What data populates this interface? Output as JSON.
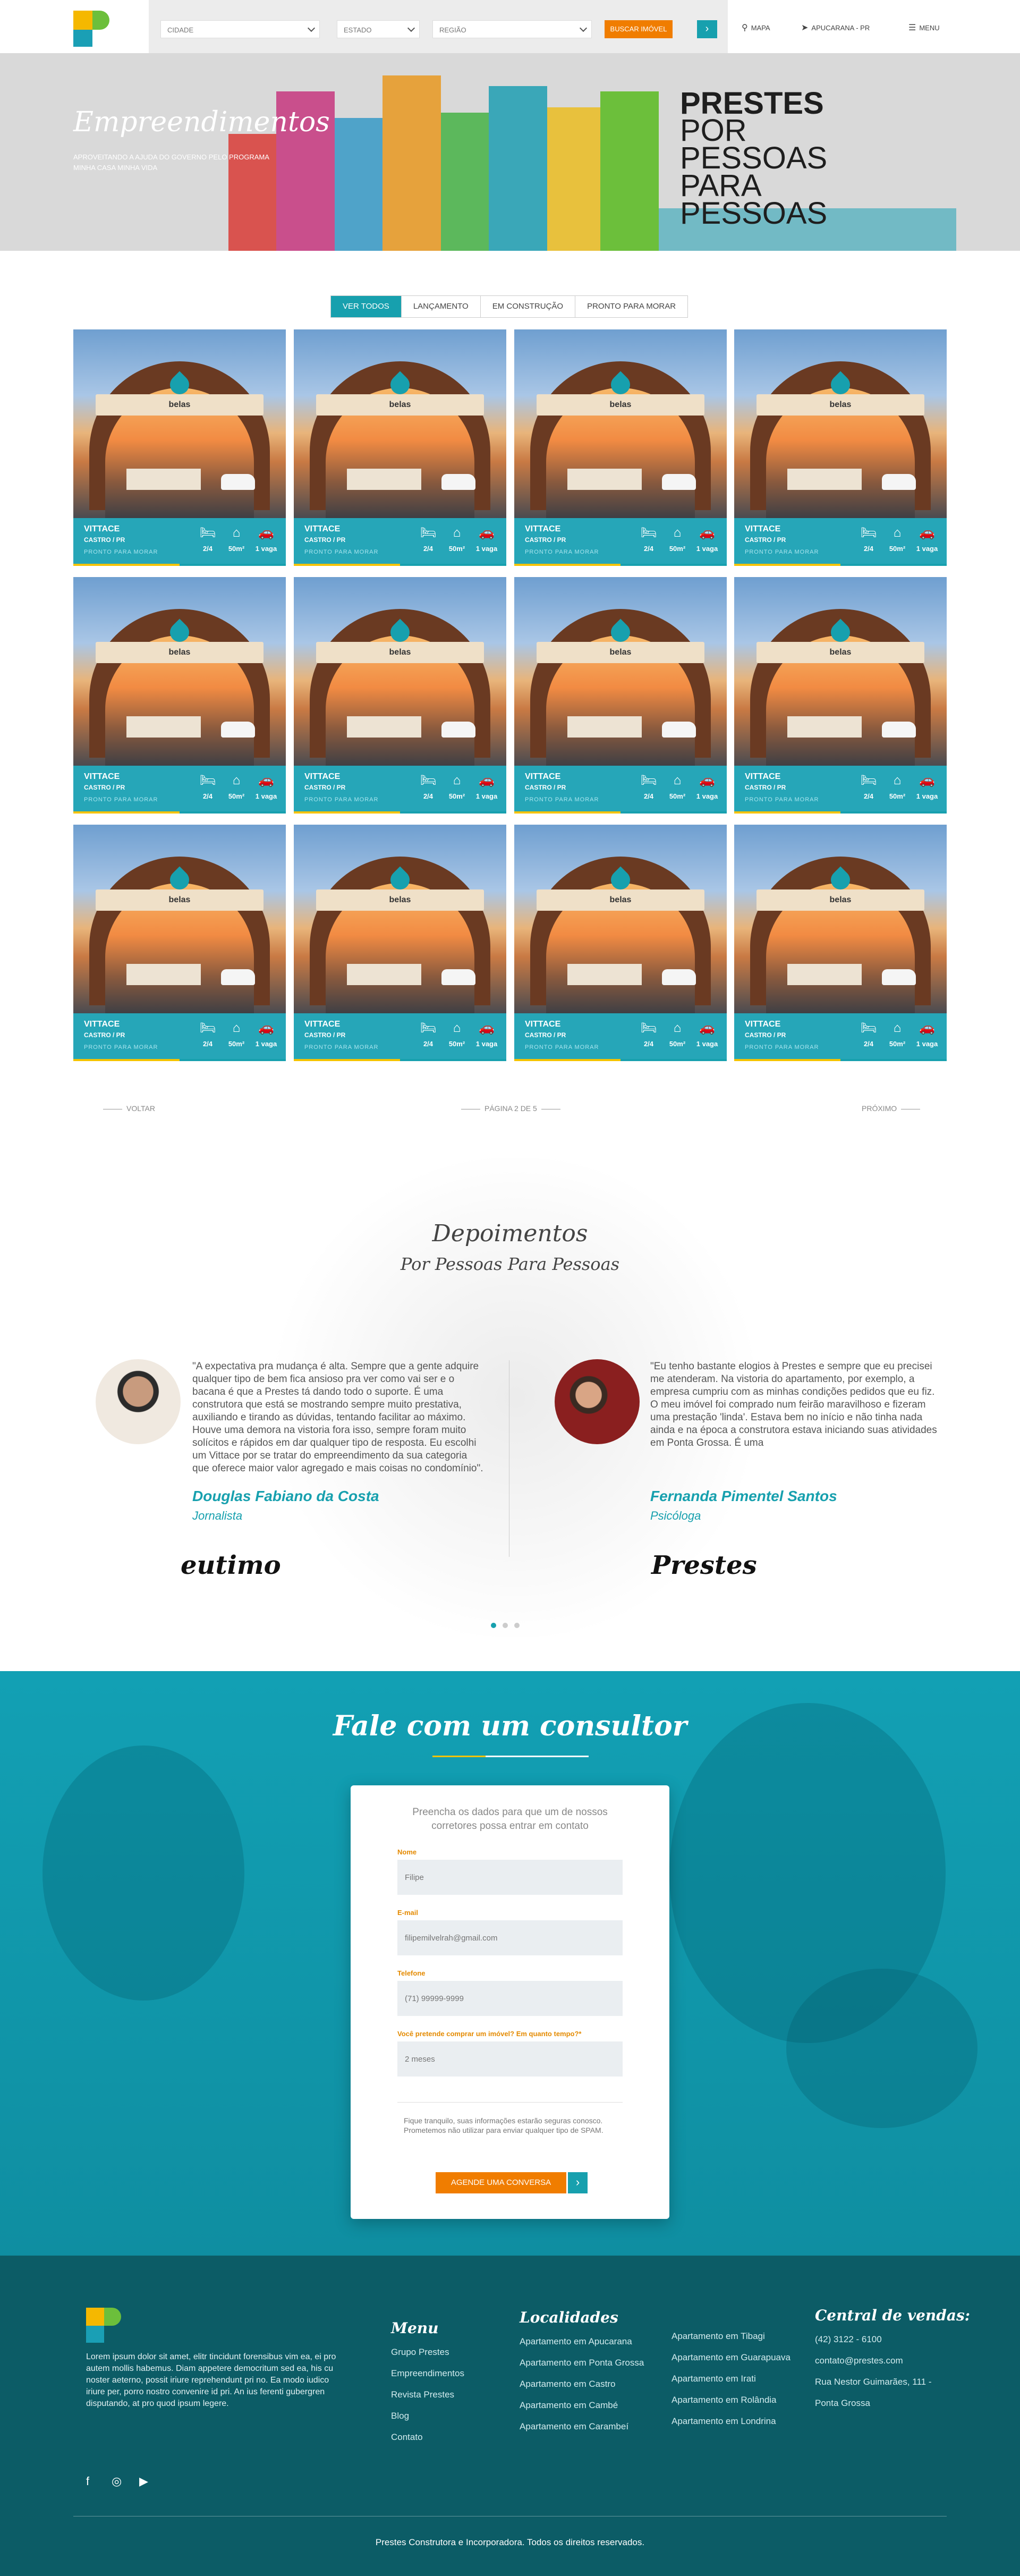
{
  "header": {
    "city_placeholder": "CIDADE",
    "state_placeholder": "ESTADO",
    "region_placeholder": "REGIÃO",
    "search_label": "BUSCAR IMÓVEL",
    "map_label": "MAPA",
    "location_label": "APUCARANA - PR",
    "menu_label": "MENU"
  },
  "hero": {
    "title": "Empreendimentos",
    "subtitle": "APROVEITANDO A AJUDA DO GOVERNO PELO PROGRAMA MINHA CASA MINHA VIDA",
    "brand": "PRESTES",
    "slogan": [
      "POR",
      "PESSOAS",
      "PARA",
      "PESSOAS"
    ]
  },
  "filters": {
    "tabs": [
      "VER TODOS",
      "LANÇAMENTO",
      "EM CONSTRUÇÃO",
      "PRONTO PARA MORAR"
    ],
    "active": "VER TODOS"
  },
  "cards": {
    "name": "VITTACE",
    "city": "CASTRO / PR",
    "status": "PRONTO PARA MORAR",
    "sign": "belas",
    "bedrooms": "2/4",
    "area": "50m²",
    "parking": "1 vaga"
  },
  "pagination": {
    "prev": "VOLTAR",
    "page_info": "PÁGINA 2 DE 5",
    "next": "PRÓXIMO"
  },
  "testimonials": {
    "title": "Depoimentos",
    "subtitle": "Por Pessoas Para Pessoas",
    "items": [
      {
        "quote": "\"A expectativa pra mudança é alta. Sempre que a gente adquire qualquer tipo de bem fica ansioso pra ver como vai ser e o bacana é que a Prestes tá dando todo o suporte. É uma construtora que está se mostrando sempre muito prestativa, auxiliando e tirando as dúvidas, tentando facilitar ao máximo. Houve uma demora na vistoria fora isso, sempre foram muito solícitos e rápidos em dar qualquer tipo de resposta. Eu escolhi um Vittace por se tratar do empreendimento da sua categoria que oferece maior valor agregado e mais coisas no condomínio\".",
        "name": "Douglas Fabiano da Costa",
        "role": "Jornalista",
        "signature": "eutimo"
      },
      {
        "quote": "\"Eu tenho bastante elogios à Prestes e sempre que eu precisei me atenderam. Na vistoria do apartamento, por exemplo, a empresa cumpriu com as minhas condições pedidos que eu fiz. O meu imóvel foi comprado num feirão maravilhoso e fizeram uma prestação 'linda'. Estava bem no início e não tinha nada ainda e na época a construtora estava iniciando suas atividades em Ponta Grossa. É uma",
        "name": "Fernanda Pimentel Santos",
        "role": "Psicóloga",
        "signature": "Prestes"
      }
    ]
  },
  "contact": {
    "title": "Fale com um consultor",
    "intro": "Preencha os dados para que um de nossos corretores possa entrar em contato",
    "fields": [
      {
        "label": "Nome",
        "placeholder": "Filipe"
      },
      {
        "label": "E-mail",
        "placeholder": "filipemilvelrah@gmail.com"
      },
      {
        "label": "Telefone",
        "placeholder": "(71) 99999-9999"
      },
      {
        "label": "Você pretende comprar um imóvel? Em quanto tempo?*",
        "placeholder": "2 meses"
      }
    ],
    "note": "Fique tranquilo, suas informações estarão seguras conosco. Prometemos não utilizar para enviar qualquer tipo de SPAM.",
    "submit": "AGENDE UMA CONVERSA"
  },
  "footer": {
    "about": "Lorem ipsum dolor sit amet, elitr tincidunt forensibus vim ea, ei pro autem mollis habemus. Diam appetere democritum sed ea, his cu noster aeterno, possit iriure reprehendunt pri no. Ea modo iudico iriure per, porro nostro convenire id pri. An ius ferenti gubergren disputando, at pro quod ipsum legere.",
    "menu_title": "Menu",
    "menu": [
      "Grupo Prestes",
      "Empreendimentos",
      "Revista Prestes",
      "Blog",
      "Contato"
    ],
    "locations_title": "Localidades",
    "locations_col1": [
      "Apartamento em Apucarana",
      "Apartamento em Ponta Grossa",
      "Apartamento em Castro",
      "Apartamento em Cambé",
      "Apartamento em Carambeí"
    ],
    "locations_col2": [
      "Apartamento em Tibagi",
      "Apartamento em Guarapuava",
      "Apartamento em Irati",
      "Apartamento em Rolândia",
      "Apartamento em Londrina"
    ],
    "sales_title": "Central de vendas:",
    "sales": [
      "(42) 3122 - 6100",
      "contato@prestes.com",
      "Rua Nestor Guimarães, 111 -",
      "Ponta Grossa"
    ],
    "copyright": "Prestes Construtora e Incorporadora. Todos os direitos reservados."
  },
  "colors": {
    "teal": "#17a0ae",
    "orange": "#f07d00",
    "yellow": "#f5c300",
    "footer": "#0c5c66"
  }
}
